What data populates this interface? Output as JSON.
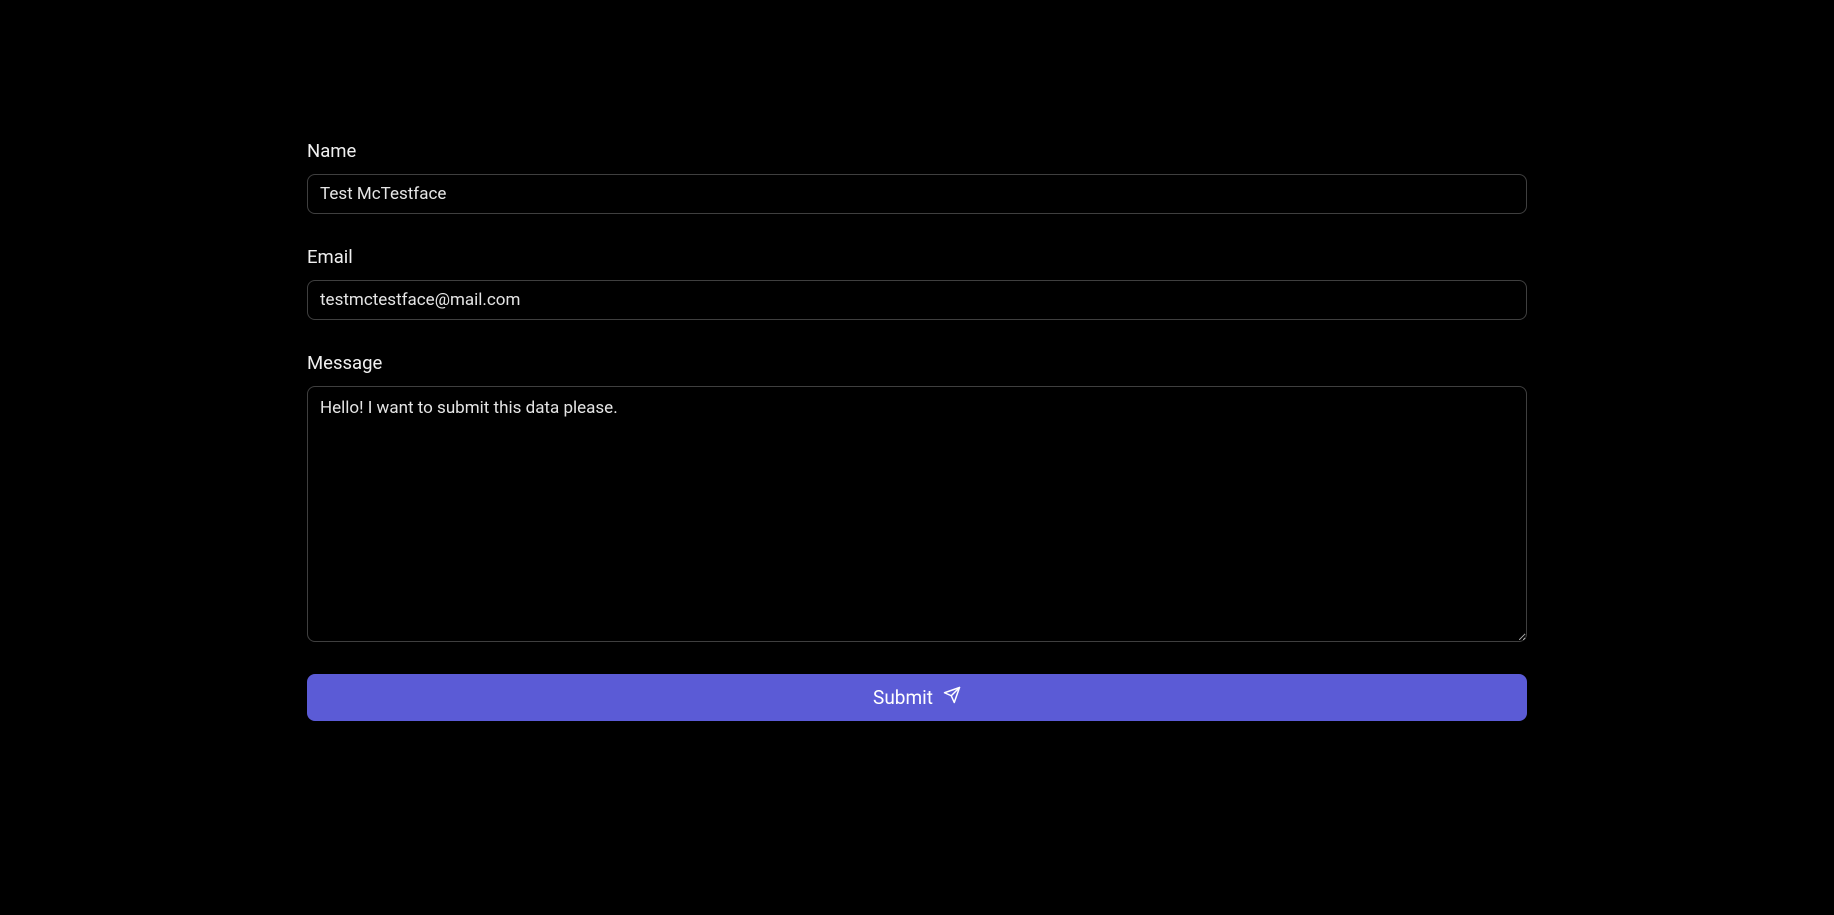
{
  "form": {
    "name": {
      "label": "Name",
      "value": "Test McTestface"
    },
    "email": {
      "label": "Email",
      "value": "testmctestface@mail.com"
    },
    "message": {
      "label": "Message",
      "value": "Hello! I want to submit this data please."
    },
    "submit_label": "Submit"
  }
}
